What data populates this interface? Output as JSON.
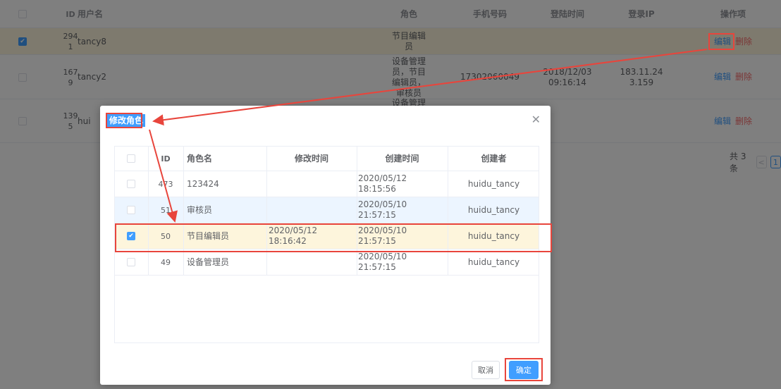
{
  "user_table": {
    "columns": {
      "id": "ID",
      "username": "用户名",
      "role": "角色",
      "phone": "手机号码",
      "login_time": "登陆时间",
      "login_ip": "登录IP",
      "ops": "操作项"
    },
    "rows": [
      {
        "id_line1": "294",
        "id_line2": "1",
        "username": "tancy8",
        "role_lines": [
          "节目编辑",
          "员"
        ],
        "phone": "",
        "login_time": "",
        "login_ip_line1": "",
        "login_ip_line2": "",
        "checked": true
      },
      {
        "id_line1": "167",
        "id_line2": "9",
        "username": "tancy2",
        "role_lines": [
          "设备管理",
          "员，节目",
          "编辑员，",
          "审核员"
        ],
        "phone": "17302060049",
        "login_time": "2018/12/03 09:16:14",
        "login_ip_line1": "183.11.24",
        "login_ip_line2": "3.159",
        "checked": false
      },
      {
        "id_line1": "139",
        "id_line2": "5",
        "username": "hui",
        "role_lines": [
          "设备管理"
        ],
        "phone": "",
        "login_time": "",
        "login_ip_line1": "",
        "login_ip_line2": "",
        "checked": false
      }
    ],
    "edit_label": "编辑",
    "delete_label": "删除"
  },
  "pagination": {
    "total_text": "共 3 条",
    "prev": "<",
    "current_page": "1"
  },
  "dialog": {
    "title": "修改角色",
    "close_icon": "close-icon",
    "columns": {
      "id": "ID",
      "name": "角色名",
      "modified": "修改时间",
      "created": "创建时间",
      "creator": "创建者"
    },
    "rows": [
      {
        "id": "473",
        "name": "123424",
        "modified": "",
        "created": "2020/05/12 18:15:56",
        "creator": "huidu_tancy",
        "checked": false
      },
      {
        "id": "51",
        "name": "审核员",
        "modified": "",
        "created": "2020/05/10 21:57:15",
        "creator": "huidu_tancy",
        "checked": false
      },
      {
        "id": "50",
        "name": "节目编辑员",
        "modified": "2020/05/12 18:16:42",
        "created": "2020/05/10 21:57:15",
        "creator": "huidu_tancy",
        "checked": true
      },
      {
        "id": "49",
        "name": "设备管理员",
        "modified": "",
        "created": "2020/05/10 21:57:15",
        "creator": "huidu_tancy",
        "checked": false
      }
    ],
    "cancel_label": "取消",
    "confirm_label": "确定"
  },
  "colors": {
    "primary": "#409eff",
    "danger": "#f56c6c",
    "highlight_row": "#fdf5dc",
    "annotation": "#e8453c"
  }
}
